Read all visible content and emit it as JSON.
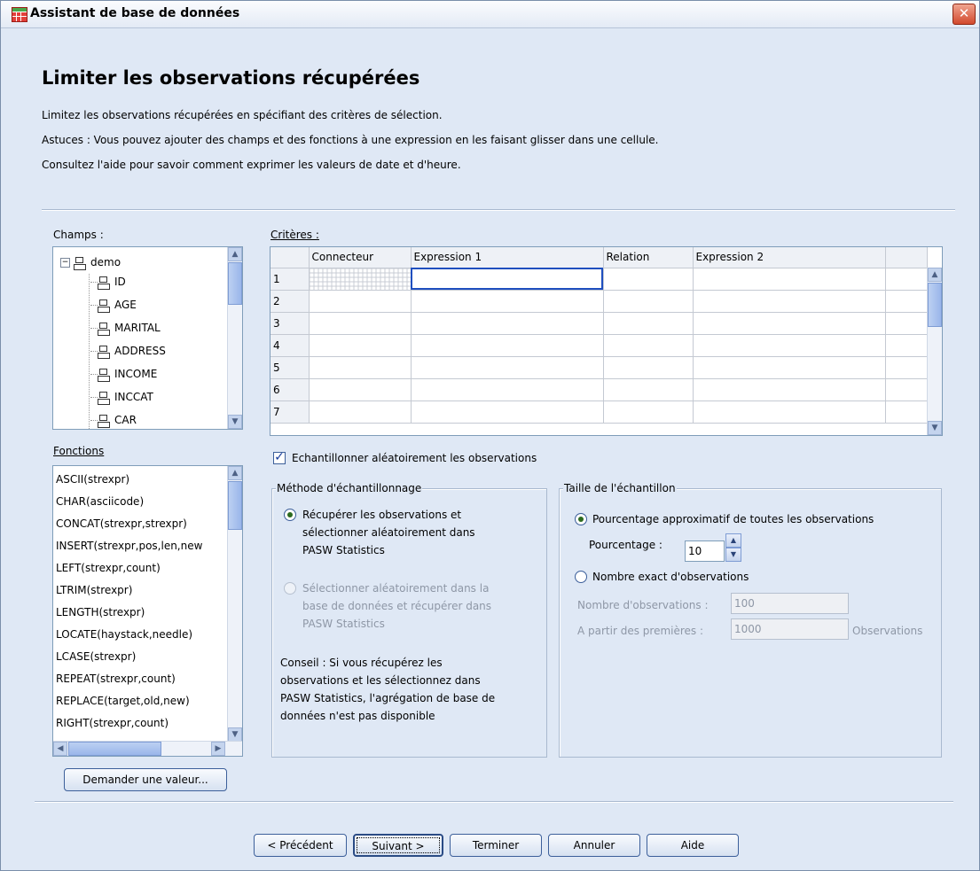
{
  "window": {
    "title": "Assistant de base de données",
    "close_glyph": "✕"
  },
  "page": {
    "title": "Limiter les observations récupérées",
    "desc1": "Limitez les observations récupérées en spécifiant des critères de sélection.",
    "desc2": "Astuces : Vous pouvez ajouter des champs et des fonctions à une expression en les faisant glisser dans une cellule.",
    "desc3": "Consultez l'aide pour savoir comment exprimer les valeurs de date et d'heure."
  },
  "fields": {
    "label": "Champs :",
    "root": "demo",
    "items": [
      "ID",
      "AGE",
      "MARITAL",
      "ADDRESS",
      "INCOME",
      "INCCAT",
      "CAR"
    ]
  },
  "functions": {
    "label": "Fonctions",
    "items": [
      "ASCII(strexpr)",
      "CHAR(asciicode)",
      "CONCAT(strexpr,strexpr)",
      "INSERT(strexpr,pos,len,new",
      "LEFT(strexpr,count)",
      "LTRIM(strexpr)",
      "LENGTH(strexpr)",
      "LOCATE(haystack,needle)",
      "LCASE(strexpr)",
      "REPEAT(strexpr,count)",
      "REPLACE(target,old,new)",
      "RIGHT(strexpr,count)"
    ],
    "prompt_button": "Demander une valeur..."
  },
  "criteria": {
    "label": "Critères :",
    "columns": [
      "Connecteur",
      "Expression 1",
      "Relation",
      "Expression 2"
    ],
    "rows": [
      "1",
      "2",
      "3",
      "4",
      "5",
      "6",
      "7"
    ]
  },
  "sample": {
    "checkbox_label": "Echantillonner aléatoirement les observations",
    "checked": true,
    "method": {
      "title": "Méthode d'échantillonnage",
      "option1_line1": "Récupérer les observations et",
      "option1_line2": "sélectionner aléatoirement dans",
      "option1_line3": "PASW Statistics",
      "option2_line1": "Sélectionner aléatoirement dans la",
      "option2_line2": "base de données et récupérer dans",
      "option2_line3": "PASW Statistics",
      "hint_line1": "Conseil : Si vous récupérez les",
      "hint_line2": "observations et les sélectionnez dans",
      "hint_line3": "PASW Statistics, l'agrégation de base de",
      "hint_line4": "données n'est pas disponible"
    },
    "size": {
      "title": "Taille de l'échantillon",
      "option1": "Pourcentage approximatif de toutes les observations",
      "percent_label": "Pourcentage :",
      "percent_value": "10",
      "option2": "Nombre exact d'observations",
      "count_label": "Nombre d'observations :",
      "count_value": "100",
      "first_label": "A partir des premières :",
      "first_value": "1000",
      "first_unit": "Observations"
    }
  },
  "nav": {
    "prev": "< Précédent",
    "next": "Suivant >",
    "finish": "Terminer",
    "cancel": "Annuler",
    "help": "Aide"
  },
  "colors": {
    "accent": "#1f4fbf",
    "background": "#dfe8f5",
    "close": "#d2492d"
  }
}
